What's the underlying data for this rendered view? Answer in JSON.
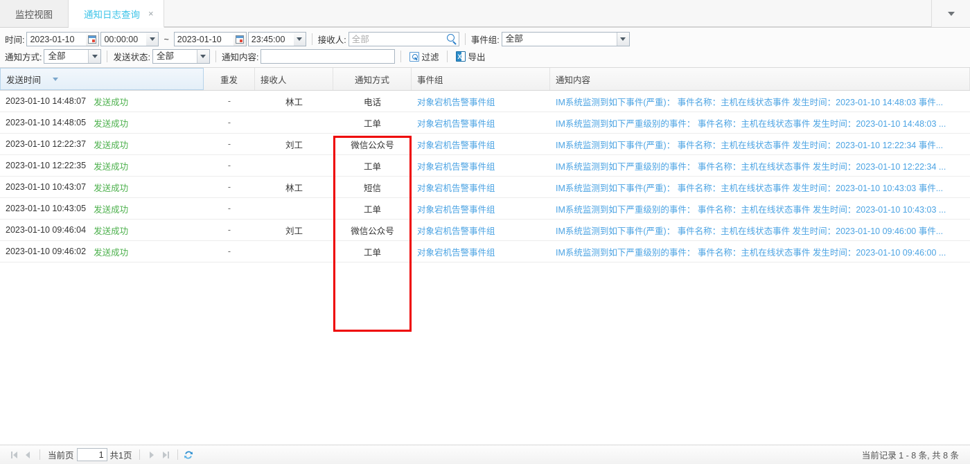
{
  "tabs": [
    {
      "label": "监控视图",
      "active": false,
      "closable": false
    },
    {
      "label": "通知日志查询",
      "active": true,
      "closable": true,
      "close": "×"
    }
  ],
  "tab_overflow_icon": "chevron-down-icon",
  "toolbar": {
    "time_label": "时间:",
    "date_from": "2023-01-10",
    "time_from": "00:00:00",
    "range_sep": "~",
    "date_to": "2023-01-10",
    "time_to": "23:45:00",
    "receiver_label": "接收人:",
    "receiver_placeholder": "全部",
    "receiver_value": "",
    "event_group_label": "事件组:",
    "event_group_value": "全部",
    "notify_type_label": "通知方式:",
    "notify_type_value": "全部",
    "send_status_label": "发送状态:",
    "send_status_value": "全部",
    "notify_content_label": "通知内容:",
    "notify_content_value": "",
    "filter_button": "过滤",
    "export_button": "导出"
  },
  "grid": {
    "columns": [
      {
        "key": "time",
        "label": "发送时间",
        "sorted": true,
        "sort_dir": "desc"
      },
      {
        "key": "resend",
        "label": "重发",
        "sorted": false
      },
      {
        "key": "receiver",
        "label": "接收人",
        "sorted": false
      },
      {
        "key": "way",
        "label": "通知方式",
        "sorted": false
      },
      {
        "key": "group",
        "label": "事件组",
        "sorted": false
      },
      {
        "key": "content",
        "label": "通知内容",
        "sorted": false
      }
    ],
    "rows": [
      {
        "time": "2023-01-10 14:48:07",
        "status": "发送成功",
        "resend": "-",
        "receiver": "林工",
        "way": "电话",
        "group": "对象宕机告警事件组",
        "content": "IM系统监测到如下事件(严重)：  事件名称：主机在线状态事件 发生时间：2023-01-10 14:48:03 事件..."
      },
      {
        "time": "2023-01-10 14:48:05",
        "status": "发送成功",
        "resend": "-",
        "receiver": "",
        "way": "工单",
        "group": "对象宕机告警事件组",
        "content": "IM系统监测到如下严重级别的事件：  事件名称：主机在线状态事件 发生时间：2023-01-10 14:48:03 ..."
      },
      {
        "time": "2023-01-10 12:22:37",
        "status": "发送成功",
        "resend": "-",
        "receiver": "刘工",
        "way": "微信公众号",
        "group": "对象宕机告警事件组",
        "content": "IM系统监测到如下事件(严重)：  事件名称：主机在线状态事件 发生时间：2023-01-10 12:22:34 事件..."
      },
      {
        "time": "2023-01-10 12:22:35",
        "status": "发送成功",
        "resend": "-",
        "receiver": "",
        "way": "工单",
        "group": "对象宕机告警事件组",
        "content": "IM系统监测到如下严重级别的事件：  事件名称：主机在线状态事件 发生时间：2023-01-10 12:22:34 ..."
      },
      {
        "time": "2023-01-10 10:43:07",
        "status": "发送成功",
        "resend": "-",
        "receiver": "林工",
        "way": "短信",
        "group": "对象宕机告警事件组",
        "content": "IM系统监测到如下事件(严重)：  事件名称：主机在线状态事件 发生时间：2023-01-10 10:43:03 事件..."
      },
      {
        "time": "2023-01-10 10:43:05",
        "status": "发送成功",
        "resend": "-",
        "receiver": "",
        "way": "工单",
        "group": "对象宕机告警事件组",
        "content": "IM系统监测到如下严重级别的事件：  事件名称：主机在线状态事件 发生时间：2023-01-10 10:43:03 ..."
      },
      {
        "time": "2023-01-10 09:46:04",
        "status": "发送成功",
        "resend": "-",
        "receiver": "刘工",
        "way": "微信公众号",
        "group": "对象宕机告警事件组",
        "content": "IM系统监测到如下事件(严重)：  事件名称：主机在线状态事件 发生时间：2023-01-10 09:46:00 事件..."
      },
      {
        "time": "2023-01-10 09:46:02",
        "status": "发送成功",
        "resend": "-",
        "receiver": "",
        "way": "工单",
        "group": "对象宕机告警事件组",
        "content": "IM系统监测到如下严重级别的事件：  事件名称：主机在线状态事件 发生时间：2023-01-10 09:46:00 ..."
      }
    ]
  },
  "highlight": {
    "column": "通知方式",
    "color": "#ee0000"
  },
  "pager": {
    "first_icon": "first-page-icon",
    "prev_icon": "previous-page-icon",
    "current_label": "当前页",
    "current_page": "1",
    "total_pages_label": "共1页",
    "next_icon": "next-page-icon",
    "last_icon": "last-page-icon",
    "refresh_icon": "refresh-icon",
    "record_summary": "当前记录 1 - 8 条,  共 8 条"
  },
  "colors": {
    "accent": "#3ec4e8",
    "link": "#4ba3e3",
    "success": "#4cb04c",
    "highlight": "#ee0000"
  }
}
